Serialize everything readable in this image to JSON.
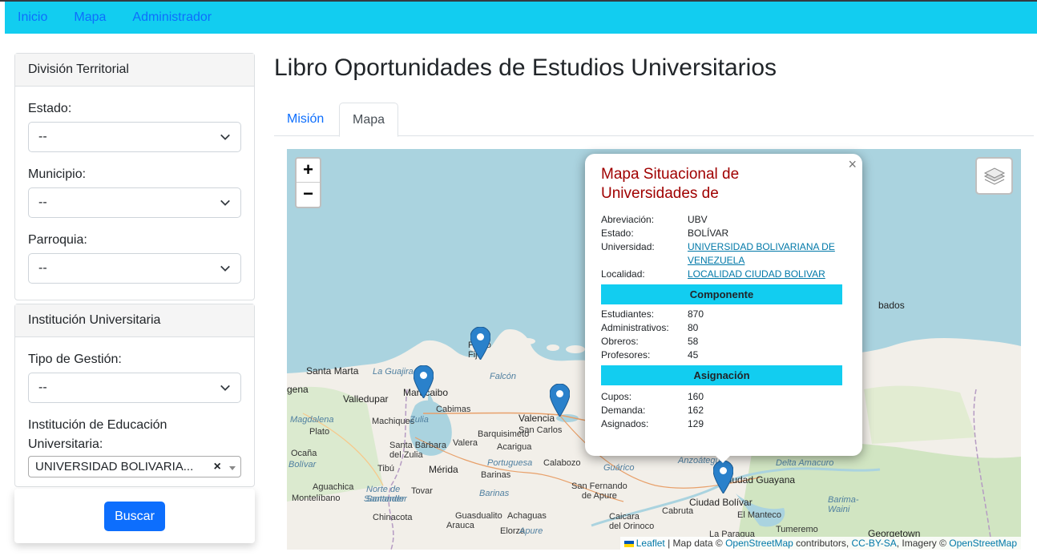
{
  "nav": {
    "items": [
      "Inicio",
      "Mapa",
      "Administrador"
    ]
  },
  "sidebar": {
    "division": {
      "header": "División Territorial",
      "estado_label": "Estado:",
      "estado_value": "--",
      "municipio_label": "Municipio:",
      "municipio_value": "--",
      "parroquia_label": "Parroquia:",
      "parroquia_value": "--"
    },
    "institucion": {
      "header": "Institución Universitaria",
      "tipo_label": "Tipo de Gestión:",
      "tipo_value": "--",
      "inst_label": "Institución de Educación Universitaria:",
      "inst_value": "UNIVERSIDAD BOLIVARIA...",
      "clear": "×"
    },
    "search_button": "Buscar"
  },
  "main": {
    "title": "Libro Oportunidades de Estudios Universitarios",
    "tabs": [
      "Misión",
      "Mapa"
    ]
  },
  "map": {
    "zoom_in": "+",
    "zoom_out": "−",
    "labels": {
      "santa_marta": "Santa Marta",
      "la_guajira": "La Guajira",
      "maracaibo": "Maracaibo",
      "punto_fijo": "Punto\nFijo",
      "falcon": "Falcón",
      "valledupar": "Valledupar",
      "cabimas": "Cabimas",
      "machiques": "Machiques",
      "zulia": "Zulia",
      "valencia": "Valencia",
      "san_carlos": "San Carlos",
      "barquisimeto": "Barquisimeto",
      "merida": "Mérida",
      "barinas": "Barinas",
      "tibu": "Tibú",
      "tovar": "Tovar",
      "acarigua": "Acarigua",
      "calabozo": "Calabozo",
      "guarico": "Guárico",
      "san_fernando": "San Fernando\nde Apure",
      "ciudad_guayana": "Ciudad Guayana",
      "ciudad_bolivar": "Ciudad Bolívar",
      "delta_amacuro": "Delta Amacuro",
      "el_manteco": "El Manteco",
      "tumeremo": "Tumeremo",
      "georgetown": "Georgetown",
      "barbados": "bados",
      "elorza": "Elorza",
      "apure": "Apure",
      "achaguas": "Achaguas",
      "guasdualito": "Guasdualito",
      "arauca": "Arauca",
      "chinacota": "Chinacota",
      "santander": "Santander",
      "aguachica": "Aguachica",
      "el_plato": "Plato",
      "magdalena": "Magdalena",
      "montelibano": "Montelíbano",
      "bolivar_col": "Bolívar",
      "valera": "Valera",
      "santa_barbara": "Santa Bárbara\ndel Zulia",
      "portuguesa": "Portuguesa",
      "cabruta": "Cabruta",
      "caicara": "Caicara\ndel Orinoco",
      "la_paragua": "La Paragua",
      "anzoategui": "Anzoátegui",
      "barima": "Barima-\nWaini",
      "norte": "Norte de\nSantander",
      "ocana": "Ocaña",
      "genal": "gena"
    },
    "attribution": {
      "leaflet": "Leaflet",
      "sep1": " | Map data © ",
      "osm": "OpenStreetMap",
      "contrib": " contributors, ",
      "ccbysa": "CC-BY-SA",
      "imagery": ", Imagery © ",
      "osm2": "OpenStreetMap"
    }
  },
  "popup": {
    "close": "×",
    "title": "Mapa Situacional de Universidades de",
    "rows": [
      {
        "k": "Abreviación:",
        "v": "UBV"
      },
      {
        "k": "Estado:",
        "v": "BOLÍVAR"
      },
      {
        "k": "Universidad:",
        "v": "UNIVERSIDAD BOLIVARIANA DE VENEZUELA"
      },
      {
        "k": "Localidad:",
        "v": "LOCALIDAD CIUDAD BOLIVAR"
      }
    ],
    "componente_header": "Componente",
    "componente": [
      {
        "k": "Estudiantes:",
        "v": "870"
      },
      {
        "k": "Administrativos:",
        "v": "80"
      },
      {
        "k": "Obreros:",
        "v": "58"
      },
      {
        "k": "Profesores:",
        "v": "45"
      }
    ],
    "asignacion_header": "Asignación",
    "asignacion": [
      {
        "k": "Cupos:",
        "v": "160"
      },
      {
        "k": "Demanda:",
        "v": "162"
      },
      {
        "k": "Asignados:",
        "v": "129"
      }
    ]
  }
}
